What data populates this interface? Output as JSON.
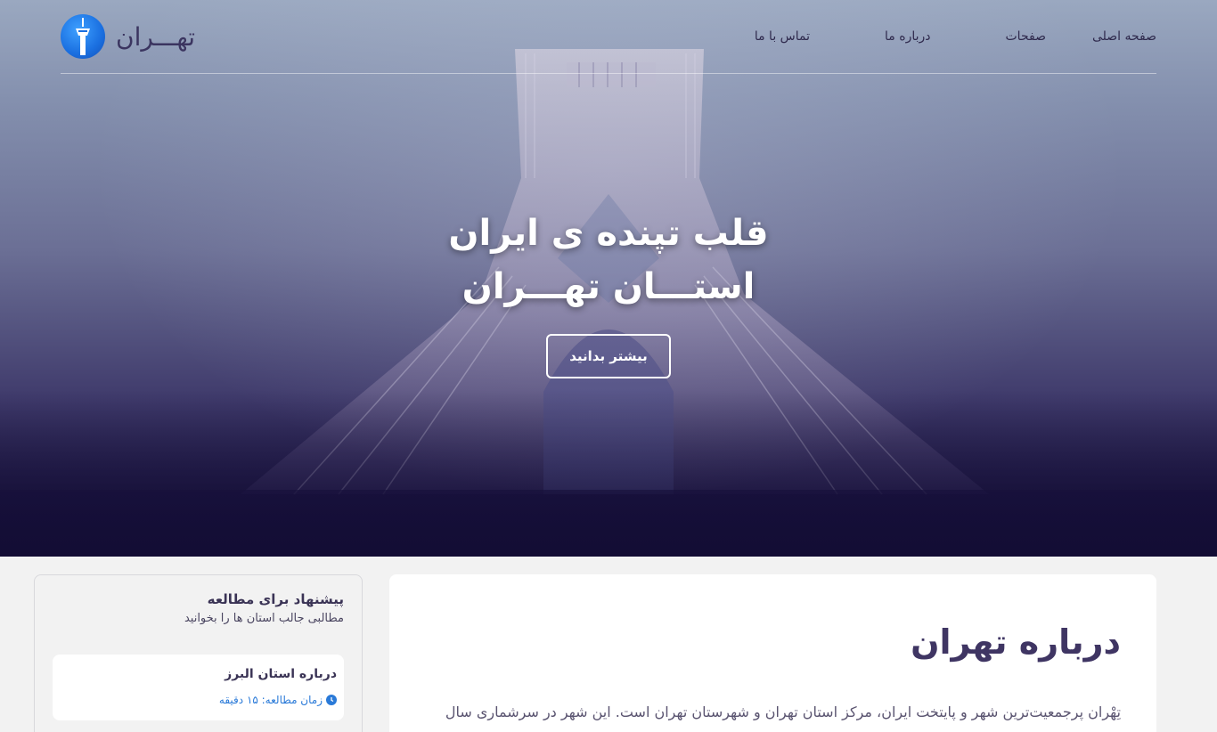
{
  "brand": {
    "name": "تهـــران",
    "logo_icon": "milad-tower-icon"
  },
  "nav": {
    "items": [
      "صفحه اصلی",
      "صفحات",
      "درباره ما",
      "تماس با ما"
    ]
  },
  "hero": {
    "title_line1": "قلب تپنده ی ایران",
    "title_line2": "استـــان تهـــران",
    "cta_label": "بیشتر بدانید"
  },
  "main": {
    "title": "درباره تهران",
    "text": "تِهْران پرجمعیت‌ترین شهر و پایتخت ایران، مرکز استان تهران و شهرستان تهران است. این شهر در سرشماری سال"
  },
  "sidebar": {
    "title": "پیشنهاد برای مطالعه",
    "subtitle": "مطالبی جالب استان ها را بخوانید",
    "items": [
      {
        "title": "درباره استان البرز",
        "meta": "زمان مطالعه: ۱۵ دقیقه",
        "icon": "clock-icon"
      }
    ]
  },
  "colors": {
    "accent": "#2a7ad8",
    "heading": "#3f3563",
    "hero_bottom": "#120c33"
  }
}
